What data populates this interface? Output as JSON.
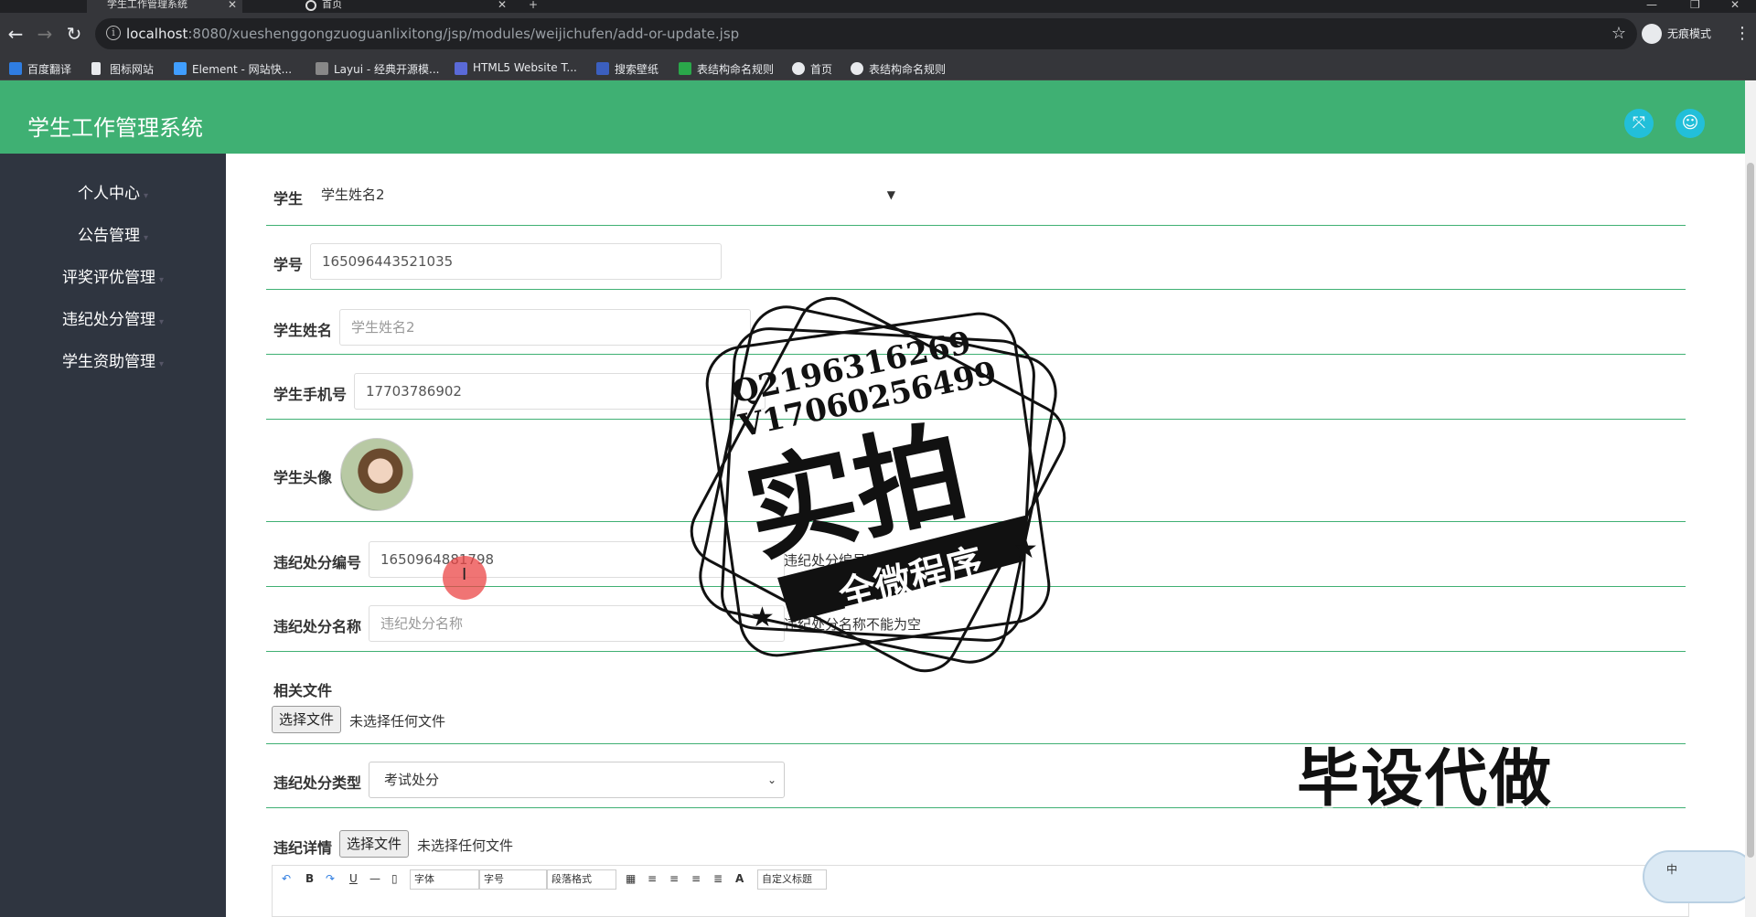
{
  "browser": {
    "tabs": [
      {
        "label": "学生工作管理系统",
        "active": true
      },
      {
        "label": "首页",
        "active": false
      }
    ],
    "url_host": "localhost",
    "url_rest": ":8080/xueshenggongzuoguanlixitong/jsp/modules/weijichufen/add-or-update.jsp",
    "profile_label": "无痕模式",
    "bookmarks": [
      "百度翻译",
      "图标网站",
      "Element - 网站快...",
      "Layui - 经典开源模...",
      "HTML5 Website T...",
      "搜索壁纸",
      "表结构命名规则",
      "首页",
      "表结构命名规则"
    ]
  },
  "app": {
    "title": "学生工作管理系统",
    "accent": "#3fb073",
    "header_icons": [
      "fullscreen-icon",
      "user-icon"
    ]
  },
  "sidebar": {
    "items": [
      {
        "label": "个人中心"
      },
      {
        "label": "公告管理"
      },
      {
        "label": "评奖评优管理"
      },
      {
        "label": "违纪处分管理"
      },
      {
        "label": "学生资助管理"
      }
    ]
  },
  "form": {
    "student": {
      "label": "学生",
      "value": "学生姓名2"
    },
    "student_no": {
      "label": "学号",
      "value": "165096443521035"
    },
    "student_name": {
      "label": "学生姓名",
      "placeholder": "学生姓名2"
    },
    "student_phone": {
      "label": "学生手机号",
      "value": "17703786902"
    },
    "student_avatar": {
      "label": "学生头像"
    },
    "punish_no": {
      "label": "违纪处分编号",
      "value": "1650964881798",
      "error": "违纪处分编号不"
    },
    "punish_name": {
      "label": "违纪处分名称",
      "placeholder": "违纪处分名称",
      "error": "违纪处分名称不能为空"
    },
    "related_file": {
      "label": "相关文件",
      "button": "选择文件",
      "status": "未选择任何文件"
    },
    "punish_type": {
      "label": "违纪处分类型",
      "value": "考试处分"
    },
    "punish_detail": {
      "label": "违纪详情",
      "button": "选择文件",
      "status": "未选择任何文件"
    },
    "editor_toolbar": {
      "font": "字体",
      "size": "字号",
      "paragraph": "段落格式",
      "custom_title": "自定义标题"
    }
  },
  "watermark": {
    "qq": "Q2196316269",
    "wechat": "V17060256499",
    "stamp_main": "实拍",
    "stamp_ribbon": "全微程序",
    "corner": "毕设代做",
    "ime": "中"
  }
}
